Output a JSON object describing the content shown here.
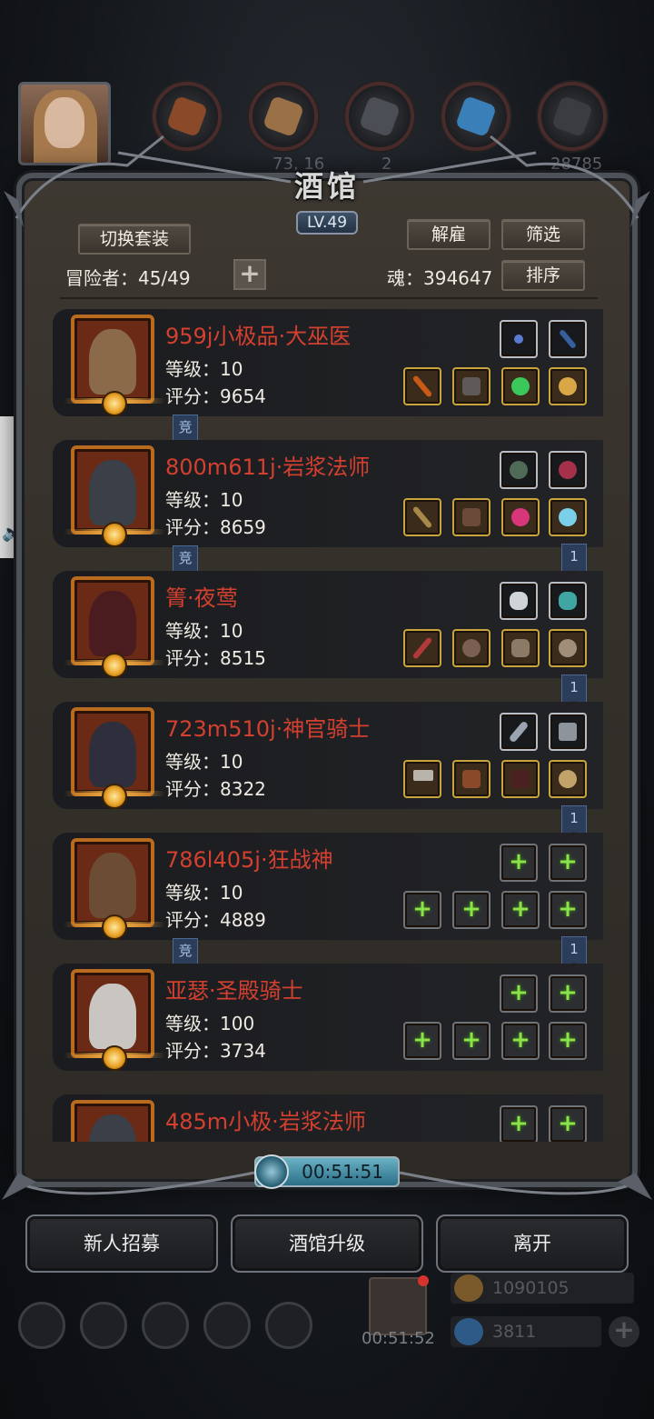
{
  "header": {
    "title": "酒馆",
    "level": "LV.49",
    "switch_outfit_label": "切换套装",
    "dismiss_label": "解雇",
    "filter_label": "筛选",
    "sort_label": "排序",
    "adventurer_label": "冒险者：45/49",
    "soul_label": "魂：394647"
  },
  "background_hud": {
    "resource_values": [
      "73, 16",
      "2",
      "28785"
    ]
  },
  "heroes": [
    {
      "name": "959j小极品·大巫医",
      "level": "等级：10",
      "score": "评分：9654",
      "portrait_color": "#7b5a3a",
      "tag": "竞"
    },
    {
      "name": "800m611j·岩浆法师",
      "level": "等级：10",
      "score": "评分：8659",
      "portrait_color": "#3a3f48",
      "tag": "竞",
      "badge": "1"
    },
    {
      "name": "箐·夜莺",
      "level": "等级：10",
      "score": "评分：8515",
      "portrait_color": "#4a1c20",
      "badge": "1"
    },
    {
      "name": "723m510j·神官骑士",
      "level": "等级：10",
      "score": "评分：8322",
      "portrait_color": "#2e2e3d",
      "badge": "1"
    },
    {
      "name": "786l405j·狂战神",
      "level": "等级：10",
      "score": "评分：4889",
      "portrait_color": "#6d4c36",
      "tag": "竞",
      "badge": "1"
    },
    {
      "name": "亚瑟·圣殿骑士",
      "level": "等级：100",
      "score": "评分：3734",
      "portrait_color": "#c9c6c2"
    },
    {
      "name": "485m小极·岩浆法师",
      "level": "",
      "score": "",
      "portrait_color": "#3a3f48"
    }
  ],
  "timer": "00:51:51",
  "actions": {
    "recruit_label": "新人招募",
    "upgrade_label": "酒馆升级",
    "leave_label": "离开"
  },
  "bottom": {
    "gift_timer": "00:51:52",
    "gold_value": "1090105",
    "gem_value": "3811"
  },
  "colors": {
    "hero_name": "#d3402f",
    "equip_gold_border": "#c9a33b",
    "equip_empty_plus": "#8be24a",
    "accent_blue": "#2c3d59"
  }
}
